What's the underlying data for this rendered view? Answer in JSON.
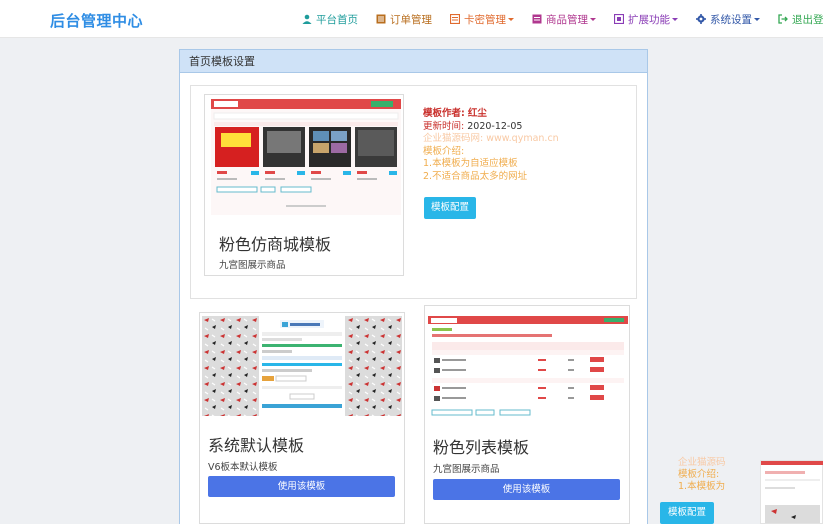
{
  "brand": "后台管理中心",
  "nav": [
    {
      "label": "平台首页",
      "icon": "user-icon",
      "color": "#1e9c9b",
      "caret": false
    },
    {
      "label": "订单管理",
      "icon": "list-icon",
      "color": "#b86e1e",
      "caret": false
    },
    {
      "label": "卡密管理",
      "icon": "card-icon",
      "color": "#e06a2e",
      "caret": true
    },
    {
      "label": "商品管理",
      "icon": "shop-icon",
      "color": "#b0388f",
      "caret": true
    },
    {
      "label": "扩展功能",
      "icon": "extension-icon",
      "color": "#8a3db6",
      "caret": true
    },
    {
      "label": "系统设置",
      "icon": "gear-icon",
      "color": "#3358a8",
      "caret": true
    },
    {
      "label": "退出登陆",
      "icon": "logout-icon",
      "color": "#34a853",
      "caret": false
    }
  ],
  "panel": {
    "title": "首页模板设置"
  },
  "featured": {
    "title": "粉色仿商城模板",
    "desc": "九宫图展示商品",
    "author_label": "模板作者:",
    "author": "红尘",
    "updated_label": "更新时间:",
    "updated": "2020-12-05",
    "source": "企业猫源码网: www.qyman.cn",
    "intro_label": "模板介绍:",
    "intro_1": "1.本模板为自适应模板",
    "intro_2": "2.不适合商品太多的网址",
    "config_button": "模板配置"
  },
  "templates": [
    {
      "title": "系统默认模板",
      "desc": "V6板本默认模板",
      "button": "使用该模板"
    },
    {
      "title": "粉色列表模板",
      "desc": "九宫图展示商品",
      "button": "使用该模板"
    }
  ],
  "overlay": {
    "source": "企业猫源码",
    "intro_label": "模板介绍:",
    "intro_1": "1.本模板为",
    "config_button": "模板配置"
  },
  "colors": {
    "accent": "#2f8de4",
    "config": "#29b6e8",
    "use": "#4b74e6",
    "red": "#c9302c",
    "orange": "#f0ad4e"
  }
}
